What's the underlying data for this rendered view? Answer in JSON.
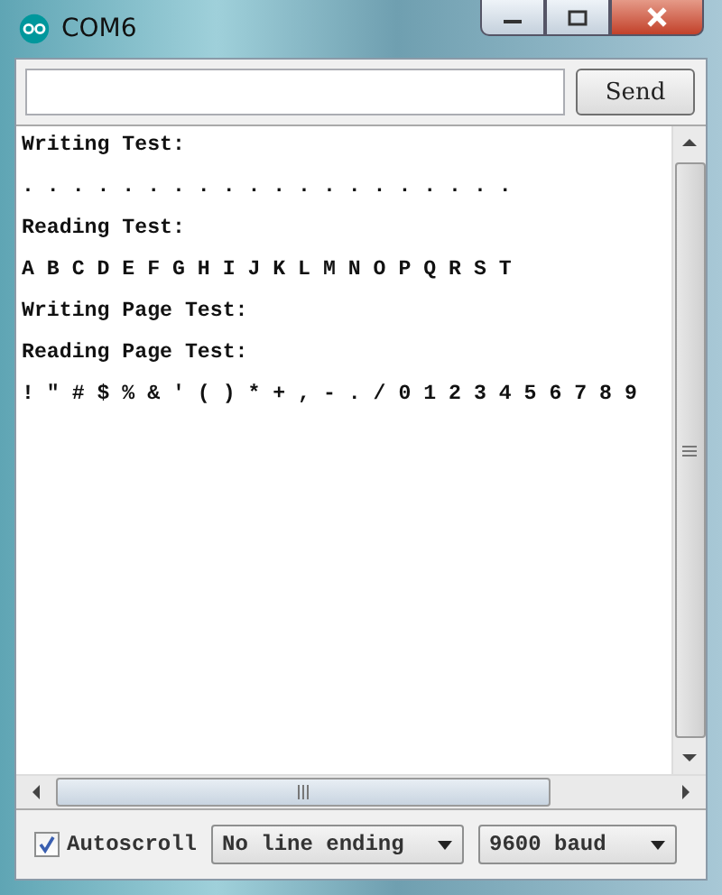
{
  "window": {
    "title": "COM6"
  },
  "send_button": {
    "label": "Send"
  },
  "output_lines": [
    "Writing Test:",
    ". . . . . . . . . . . . . . . . . . . .",
    "Reading Test:",
    "A B C D E F G H I J K L M N O P Q R S T",
    "Writing Page Test:",
    "Reading Page Test:",
    "! \" # $ % & ' ( ) * + , - . / 0 1 2 3 4 5 6 7 8 9"
  ],
  "autoscroll": {
    "label": "Autoscroll",
    "checked": true
  },
  "line_ending": {
    "value": "No line ending"
  },
  "baud": {
    "value": "9600 baud"
  }
}
